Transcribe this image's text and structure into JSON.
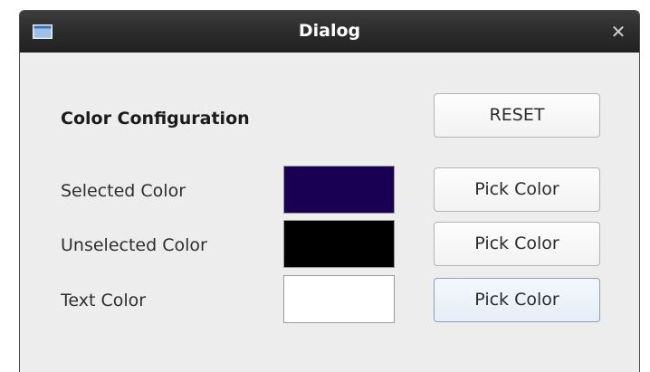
{
  "window": {
    "title": "Dialog",
    "close_symbol": "✕"
  },
  "config": {
    "heading": "Color Configuration",
    "reset_label": "RESET",
    "rows": [
      {
        "label": "Selected Color",
        "color": "#1a0052",
        "button": "Pick Color"
      },
      {
        "label": "Unselected Color",
        "color": "#000000",
        "button": "Pick Color"
      },
      {
        "label": "Text Color",
        "color": "#ffffff",
        "button": "Pick Color"
      }
    ]
  },
  "icons": {
    "window_icon": "window-icon",
    "close": "close-icon"
  },
  "colors": {
    "titlebar": "#2b2b2b",
    "background": "#ededed",
    "window_icon_fill": "#8fb3e0"
  }
}
